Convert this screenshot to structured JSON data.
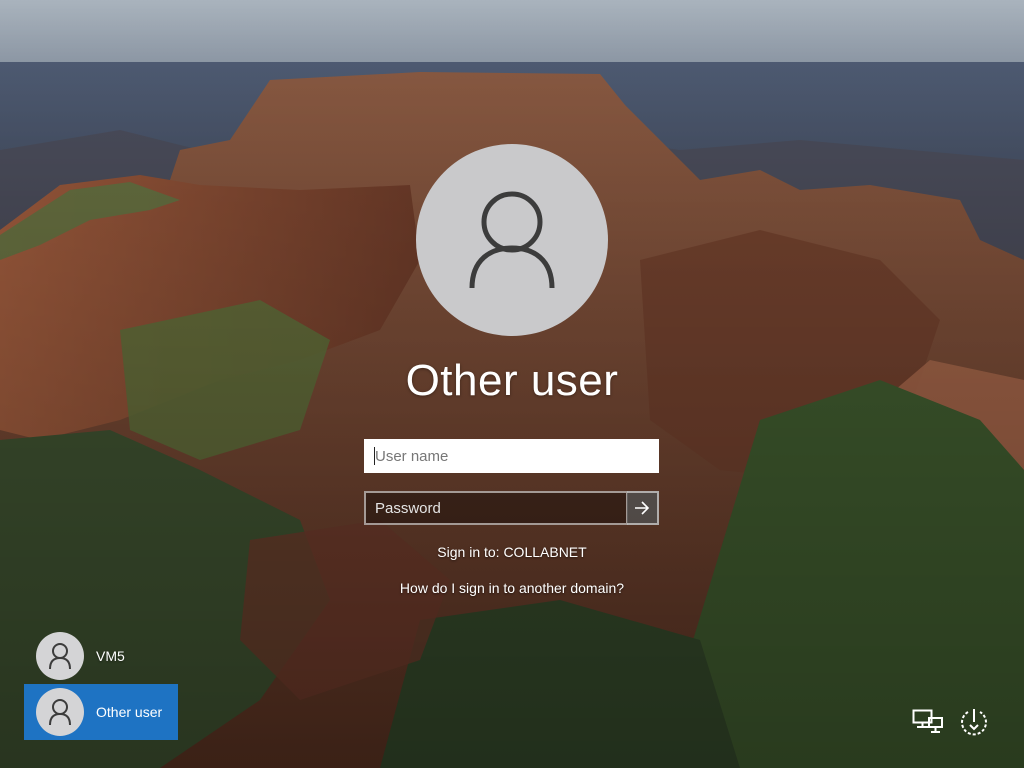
{
  "login": {
    "title": "Other user",
    "username_placeholder": "User name",
    "password_placeholder": "Password",
    "sign_in_to": "Sign in to: COLLABNET",
    "other_domain_link": "How do I sign in to another domain?"
  },
  "user_tiles": [
    {
      "label": "VM5",
      "selected": false
    },
    {
      "label": "Other user",
      "selected": true
    }
  ],
  "icons": {
    "avatar": "user-silhouette-icon",
    "submit": "arrow-right-icon",
    "network": "network-icon",
    "power": "power-icon"
  },
  "colors": {
    "accent": "#1e73c3",
    "avatar_bg": "#c9c9cb"
  }
}
